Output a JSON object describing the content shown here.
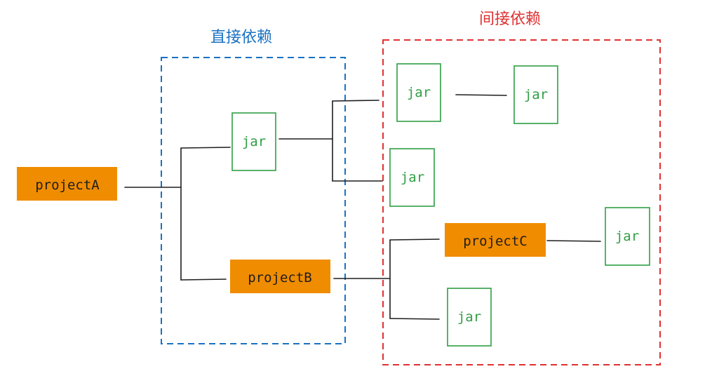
{
  "groups": {
    "direct": {
      "title": "直接依赖",
      "color": "#1971c2"
    },
    "indirect": {
      "title": "间接依赖",
      "color": "#e03131"
    }
  },
  "nodes": {
    "projectA": {
      "label": "projectA",
      "kind": "project"
    },
    "projectB": {
      "label": "projectB",
      "kind": "project"
    },
    "projectC": {
      "label": "projectC",
      "kind": "project"
    },
    "jar_direct": {
      "label": "jar",
      "kind": "jar"
    },
    "jar_ind_1": {
      "label": "jar",
      "kind": "jar"
    },
    "jar_ind_2": {
      "label": "jar",
      "kind": "jar"
    },
    "jar_ind_3": {
      "label": "jar",
      "kind": "jar"
    },
    "jar_c": {
      "label": "jar",
      "kind": "jar"
    },
    "jar_b": {
      "label": "jar",
      "kind": "jar"
    }
  },
  "colors": {
    "project_fill": "#f08c00",
    "jar_stroke": "#2f9e44",
    "jar_text": "#2f9e44",
    "project_text": "#1e1e1e",
    "connector": "#1e1e1e"
  }
}
